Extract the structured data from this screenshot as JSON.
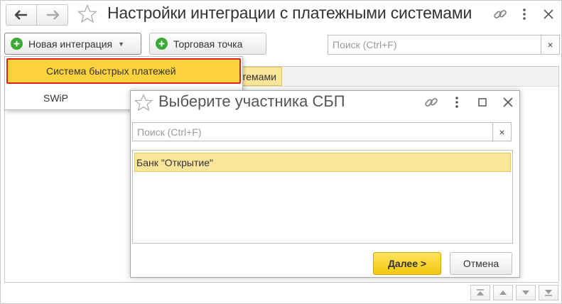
{
  "window": {
    "title": "Настройки интеграции с платежными системами"
  },
  "toolbar": {
    "new_integration_label": "Новая интеграция",
    "trade_point_label": "Торговая точка",
    "search_placeholder": "Поиск (Ctrl+F)",
    "search_clear": "×"
  },
  "list": {
    "highlighted_partial_text": "темами"
  },
  "dropdown": {
    "items": [
      {
        "label": "Система быстрых платежей",
        "selected": true
      },
      {
        "label": "SWiP",
        "selected": false
      }
    ]
  },
  "dialog": {
    "title": "Выберите участника СБП",
    "search_placeholder": "Поиск (Ctrl+F)",
    "search_clear": "×",
    "rows": [
      {
        "label": "Банк \"Открытие\"",
        "selected": true
      }
    ],
    "next_label": "Далее >",
    "cancel_label": "Отмена"
  },
  "colors": {
    "accent_yellow": "#fcd33c",
    "selection_yellow": "#fbe59a",
    "highlight_border_red": "#e02020",
    "plus_green": "#3aaa35"
  },
  "icons": [
    "back-arrow-icon",
    "forward-arrow-icon",
    "star-icon",
    "link-icon",
    "more-vertical-icon",
    "close-icon",
    "plus-icon",
    "maximize-icon",
    "scroll-first-icon",
    "scroll-up-icon",
    "scroll-down-icon",
    "scroll-last-icon"
  ]
}
